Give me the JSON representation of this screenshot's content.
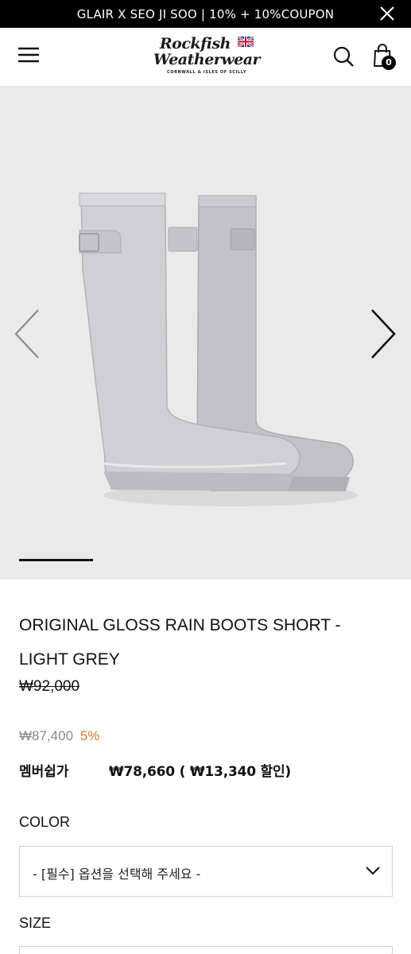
{
  "promo": {
    "text": "GLAIR X SEO JI SOO | 10% + 10%COUPON",
    "close_icon": "close-icon"
  },
  "header": {
    "logo_line1": "Rockfish",
    "logo_line2": "Weatherwear",
    "logo_sub": "CORNWALL & ISLES OF SCILLY",
    "menu_icon": "hamburger-menu-icon",
    "search_icon": "search-icon",
    "cart_icon": "shopping-bag-icon",
    "cart_count": "0"
  },
  "gallery": {
    "prev_icon": "chevron-left-icon",
    "next_icon": "chevron-right-icon",
    "background_color": "#eaeaea"
  },
  "product": {
    "title": "ORIGINAL GLOSS RAIN BOOTS SHORT - LIGHT GREY",
    "original_price": "₩92,000",
    "sale_price": "₩87,400",
    "discount_rate": "5%",
    "member_label": "멤버쉽가",
    "member_price": "₩78,660 ( ₩13,340 할인)"
  },
  "options": {
    "color_label": "COLOR",
    "color_placeholder": "- [필수] 옵션을 선택해 주세요 -",
    "size_label": "SIZE"
  },
  "colors": {
    "accent_discount": "#e07a2a",
    "sale_price": "#8a8a8a",
    "promo_bg": "#000000"
  }
}
